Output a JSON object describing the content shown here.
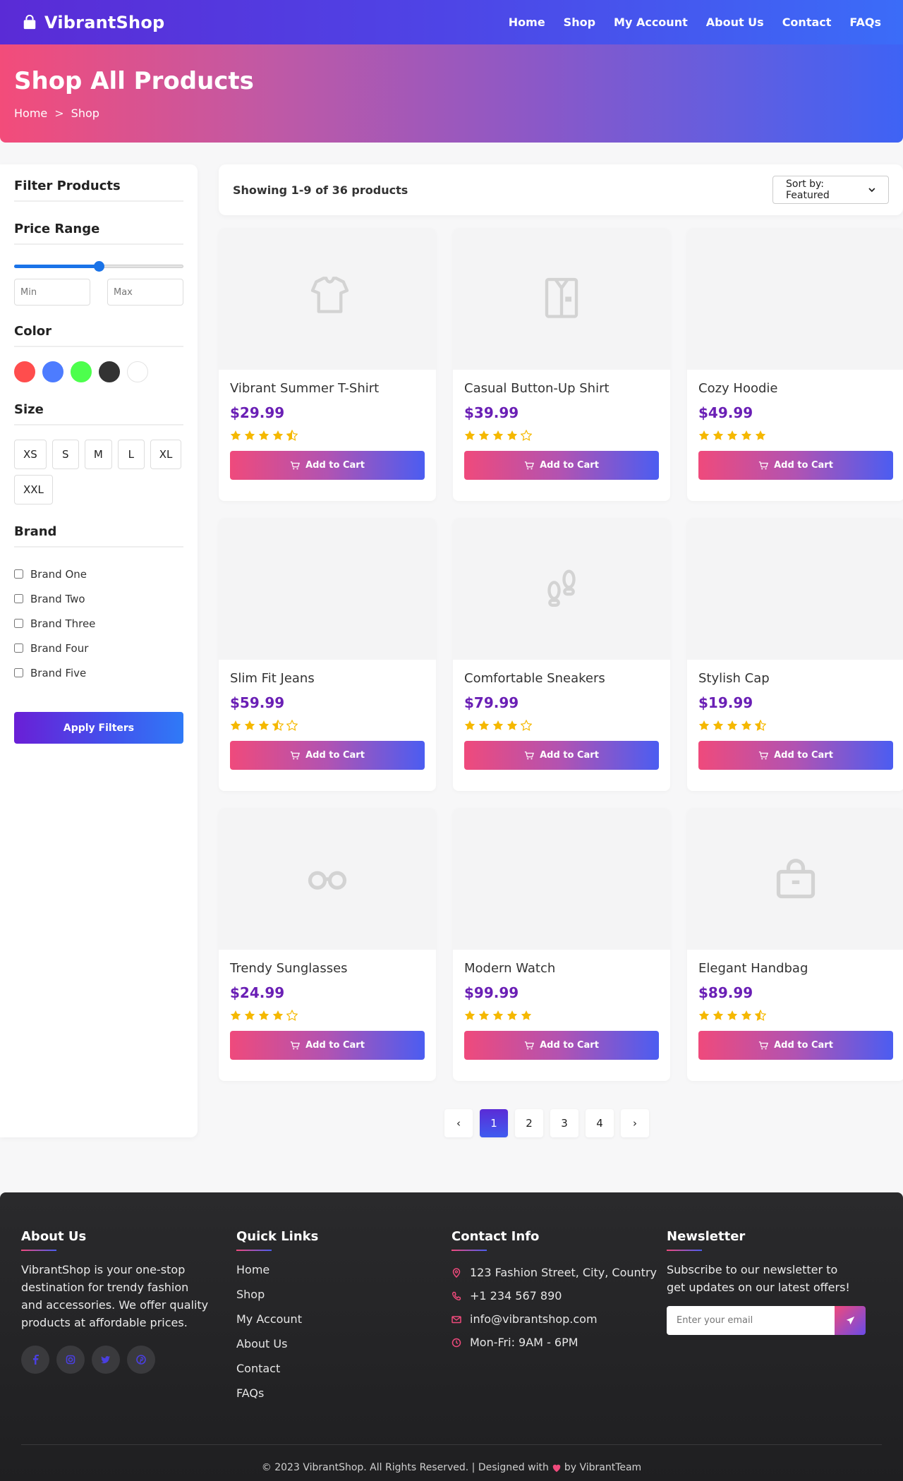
{
  "nav": {
    "brand": "VibrantShop",
    "links": [
      "Home",
      "Shop",
      "My Account",
      "About Us",
      "Contact",
      "FAQs"
    ]
  },
  "hero": {
    "title": "Shop All Products",
    "breadcrumb": [
      "Home",
      "Shop"
    ],
    "separator": ">"
  },
  "sidebar": {
    "title": "Filter Products",
    "price_title": "Price Range",
    "price_slider_value": 0.5,
    "min_placeholder": "Min",
    "max_placeholder": "Max",
    "color_title": "Color",
    "colors": [
      "#ff4d4d",
      "#4d7cff",
      "#4dff4d",
      "#333333",
      "#ffffff"
    ],
    "size_title": "Size",
    "sizes": [
      "XS",
      "S",
      "M",
      "L",
      "XL",
      "XXL"
    ],
    "brand_title": "Brand",
    "brands": [
      "Brand One",
      "Brand Two",
      "Brand Three",
      "Brand Four",
      "Brand Five"
    ],
    "apply_label": "Apply Filters"
  },
  "toolbar": {
    "showing": "Showing 1-9 of 36 products",
    "sort_selected": "Sort by: Featured"
  },
  "products": [
    {
      "name": "Vibrant Summer T-Shirt",
      "price": "$29.99",
      "rating": 4.5,
      "icon": "tshirt-icon"
    },
    {
      "name": "Casual Button-Up Shirt",
      "price": "$39.99",
      "rating": 4,
      "icon": "shirt-icon"
    },
    {
      "name": "Cozy Hoodie",
      "price": "$49.99",
      "rating": 5,
      "icon": ""
    },
    {
      "name": "Slim Fit Jeans",
      "price": "$59.99",
      "rating": 3.5,
      "icon": ""
    },
    {
      "name": "Comfortable Sneakers",
      "price": "$79.99",
      "rating": 4,
      "icon": "footprints-icon"
    },
    {
      "name": "Stylish Cap",
      "price": "$19.99",
      "rating": 4.5,
      "icon": ""
    },
    {
      "name": "Trendy Sunglasses",
      "price": "$24.99",
      "rating": 4,
      "icon": "glasses-icon"
    },
    {
      "name": "Modern Watch",
      "price": "$99.99",
      "rating": 5,
      "icon": ""
    },
    {
      "name": "Elegant Handbag",
      "price": "$89.99",
      "rating": 4.5,
      "icon": "handbag-icon"
    }
  ],
  "cart_label": "Add to Cart",
  "pagination": {
    "prev": "‹",
    "pages": [
      "1",
      "2",
      "3",
      "4"
    ],
    "active": "1",
    "next": "›"
  },
  "footer": {
    "about_title": "About Us",
    "about_text": "VibrantShop is your one-stop destination for trendy fashion and accessories. We offer quality products at affordable prices.",
    "social_icons": [
      "facebook-icon",
      "instagram-icon",
      "twitter-icon",
      "pinterest-icon"
    ],
    "quick_title": "Quick Links",
    "quick_links": [
      "Home",
      "Shop",
      "My Account",
      "About Us",
      "Contact",
      "FAQs"
    ],
    "contact_title": "Contact Info",
    "contact": [
      {
        "icon": "location-icon",
        "text": "123 Fashion Street, City, Country"
      },
      {
        "icon": "phone-icon",
        "text": "+1 234 567 890"
      },
      {
        "icon": "email-icon",
        "text": "info@vibrantshop.com"
      },
      {
        "icon": "clock-icon",
        "text": "Mon-Fri: 9AM - 6PM"
      }
    ],
    "newsletter_title": "Newsletter",
    "newsletter_text": "Subscribe to our newsletter to get updates on our latest offers!",
    "newsletter_placeholder": "Enter your email",
    "copyright_left": "© 2023 VibrantShop. All Rights Reserved. | Designed with",
    "copyright_right": "by VibrantTeam"
  },
  "colors": {
    "price": "#6a1fb5",
    "star": "#f5b800",
    "accent_pink": "#f04a7c",
    "accent_blue": "#4b5df1"
  }
}
